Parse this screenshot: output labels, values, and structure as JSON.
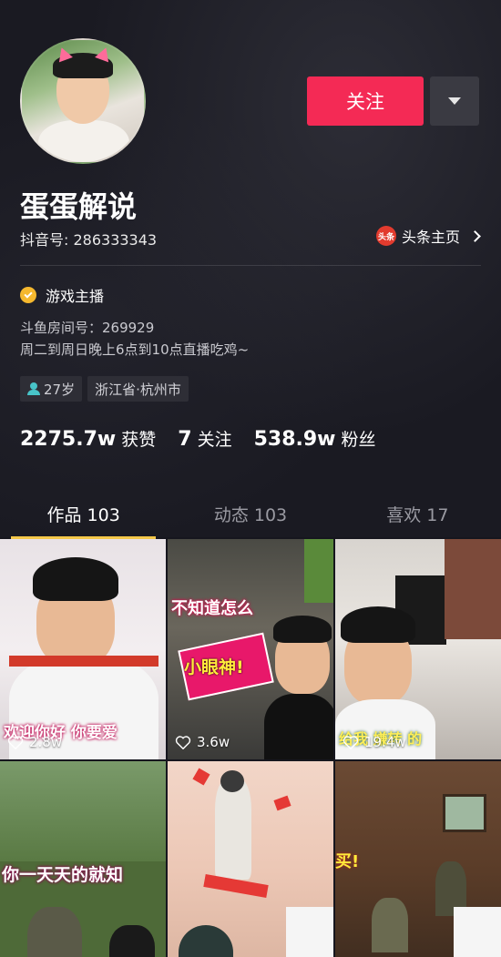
{
  "profile": {
    "nickname": "蛋蛋解说",
    "douyin_id": "抖音号: 286333343",
    "toutiao_link": "头条主页",
    "toutiao_logo_text": "头条",
    "follow_label": "关注",
    "verified_label": "游戏主播",
    "bio_line1": "斗鱼房间号：269929",
    "bio_line2": "周二到周日晚上6点到10点直播吃鸡~",
    "tags": {
      "age": "27岁",
      "location": "浙江省·杭州市"
    }
  },
  "stats": {
    "likes_num": "2275.7w",
    "likes_label": "获赞",
    "following_num": "7",
    "following_label": "关注",
    "followers_num": "538.9w",
    "followers_label": "粉丝"
  },
  "tabs": [
    {
      "label": "作品 103",
      "active": true
    },
    {
      "label": "动态 103",
      "active": false
    },
    {
      "label": "喜欢 17",
      "active": false
    }
  ],
  "videos": [
    {
      "likes": "2.8w",
      "caption": "欢迎你好 你要爱"
    },
    {
      "likes": "3.6w",
      "caption": "不知道怎么",
      "caption2": "小眼神!"
    },
    {
      "likes": "19.4w",
      "caption": "给我 嫌转 的"
    },
    {
      "likes": "",
      "caption": "你一天天的就知"
    },
    {
      "likes": "",
      "caption": ""
    },
    {
      "likes": "",
      "caption": "买!"
    }
  ],
  "colors": {
    "accent": "#f42a55",
    "tab_underline": "#f5c84a",
    "verified": "#f5b82e",
    "age_icon": "#48c4c8"
  }
}
